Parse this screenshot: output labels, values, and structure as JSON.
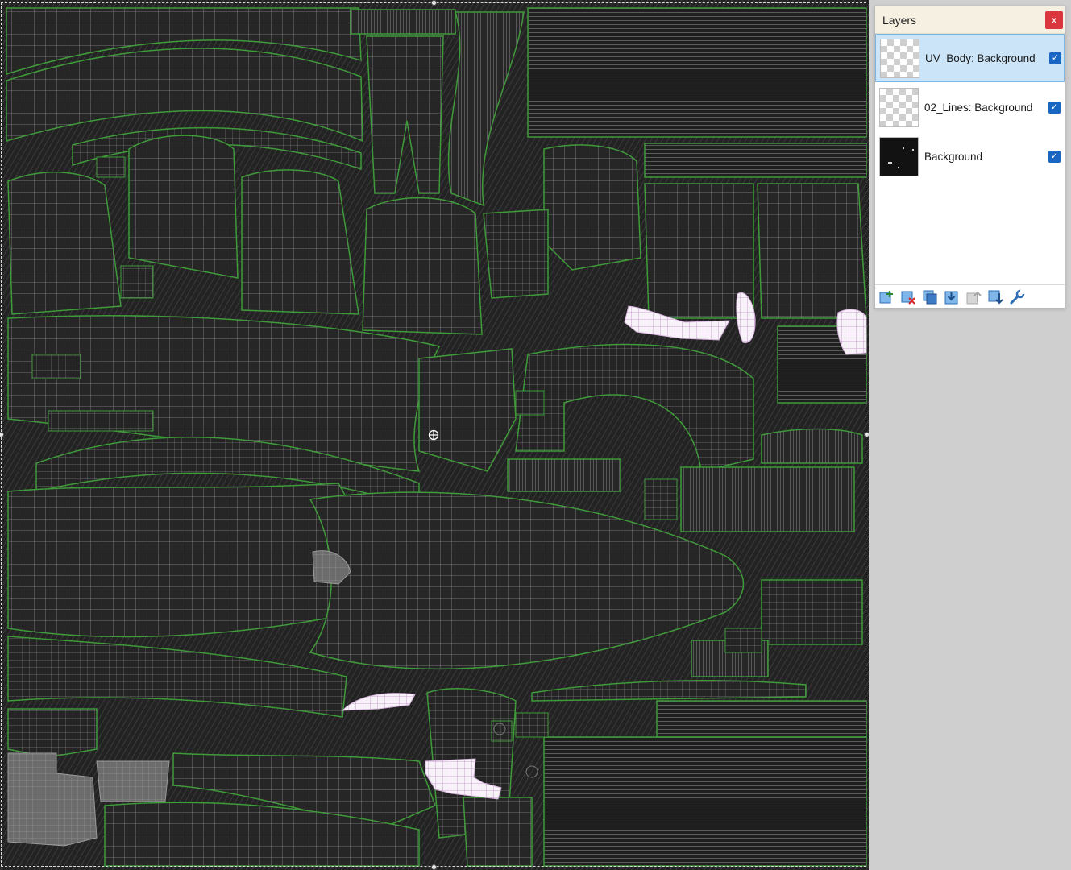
{
  "layers_panel": {
    "title": "Layers",
    "close_label": "x",
    "layers": [
      {
        "name": "UV_Body: Background",
        "visible": true,
        "selected": true,
        "thumbnail": "transparent"
      },
      {
        "name": "02_Lines: Background",
        "visible": true,
        "selected": false,
        "thumbnail": "transparent"
      },
      {
        "name": "Background",
        "visible": true,
        "selected": false,
        "thumbnail": "dark-image"
      }
    ],
    "toolbar": [
      {
        "icon": "add-layer-icon"
      },
      {
        "icon": "delete-layer-icon"
      },
      {
        "icon": "duplicate-layer-icon"
      },
      {
        "icon": "merge-layer-down-icon"
      },
      {
        "icon": "move-layer-up-icon"
      },
      {
        "icon": "move-layer-down-icon"
      },
      {
        "icon": "layer-properties-wrench-icon"
      }
    ]
  },
  "colors": {
    "canvas_background": "#1e1e1e",
    "uv_island_fill": "#262626",
    "uv_wire": "#8d8d8d",
    "uv_border": "#3f9a3a",
    "highlight_fill": "#f4f0f6",
    "highlight_wire": "#c08ac8",
    "selected_layer": "#cce4f7",
    "checkbox": "#1a66c3",
    "close_button": "#d9363e"
  }
}
